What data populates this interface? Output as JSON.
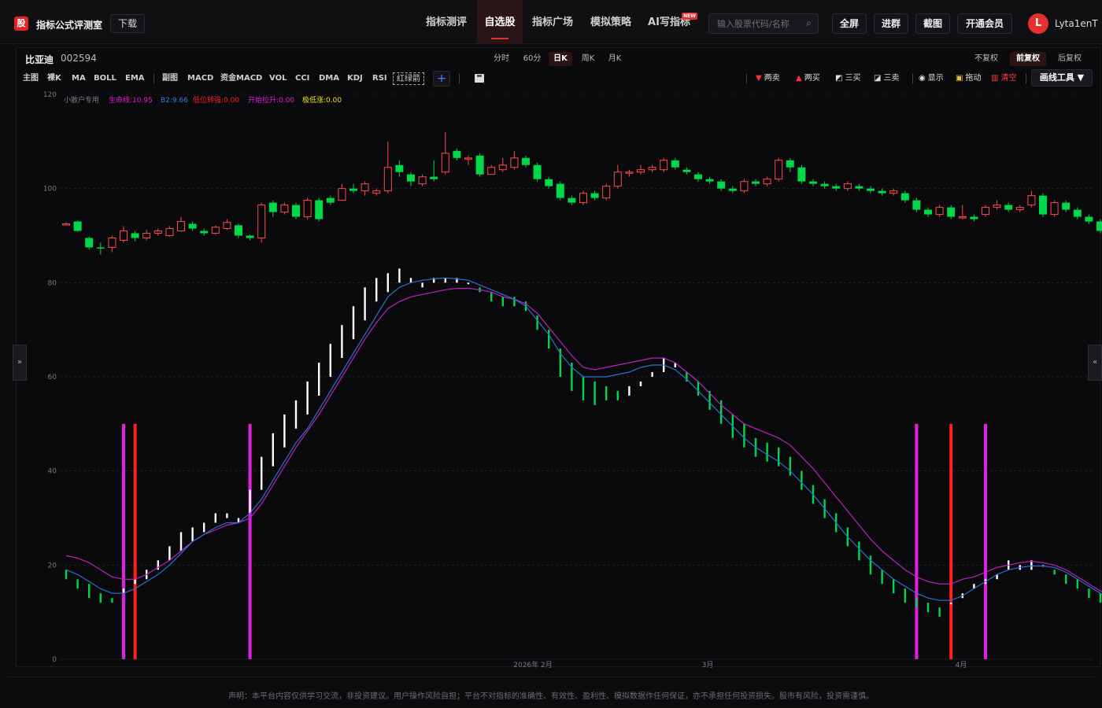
{
  "app": {
    "logo_char": "股",
    "name": "指标公式评测室",
    "download": "下载"
  },
  "nav": [
    "指标测评",
    "自选股",
    "指标广场",
    "模拟策略",
    "AI写指标"
  ],
  "nav_active": 1,
  "new_badge": "NEW",
  "search": {
    "placeholder": "输入股票代码/名称",
    "icon": "search-icon"
  },
  "header_buttons": [
    "全屏",
    "进群",
    "截图",
    "开通会员"
  ],
  "user": {
    "initial": "L",
    "name": "Lyta1enT"
  },
  "stock": {
    "name": "比亚迪",
    "code": "002594"
  },
  "periods": [
    "分时",
    "60分",
    "日K",
    "周K",
    "月K"
  ],
  "period_active": 2,
  "fq_modes": [
    "不复权",
    "前复权",
    "后复权"
  ],
  "fq_active": 1,
  "indicators": [
    "主图",
    "裸K",
    "MA",
    "BOLL",
    "EMA"
  ],
  "sub_indicators": [
    "副图",
    "MACD",
    "资金MACD",
    "VOL",
    "CCI",
    "DMA",
    "KDJ",
    "RSI"
  ],
  "red_green_arrow": "红绿箭",
  "plus": "+",
  "tools": [
    {
      "icon": "down-triangle-icon",
      "glyph": "▼",
      "label": "两卖",
      "color": "#ff3030"
    },
    {
      "icon": "up-triangle-icon",
      "glyph": "▲",
      "label": "两买",
      "color": "#ff3030"
    },
    {
      "icon": "chart-up-icon",
      "glyph": "◩",
      "label": "三买",
      "color": "#dddddd"
    },
    {
      "icon": "chart-down-icon",
      "glyph": "◪",
      "label": "三卖",
      "color": "#dddddd"
    },
    {
      "icon": "eye-icon",
      "glyph": "◉",
      "label": "显示",
      "color": "#dddddd"
    },
    {
      "icon": "lock-icon",
      "glyph": "▣",
      "label": "拖动",
      "color": "#f0c040"
    },
    {
      "icon": "trash-icon",
      "glyph": "▥",
      "label": "清空",
      "color": "#ff4040"
    }
  ],
  "draw_tool": "画线工具 ▼",
  "legend": [
    {
      "text": "小散户专用",
      "color": "#7d7d85"
    },
    {
      "text": "生命线:10.95",
      "color": "#e020e0"
    },
    {
      "text": "B2:9.66",
      "color": "#3a7be0"
    },
    {
      "text": "低位转强:0.00",
      "color": "#ff2020"
    },
    {
      "text": "开始拉升:0.00",
      "color": "#e020e0"
    },
    {
      "text": "极低涨:0.00",
      "color": "#f0e020"
    }
  ],
  "side_left": "»",
  "side_right": "«",
  "colors": {
    "up": "#ff4a4a",
    "down": "#00d84a",
    "bg": "#0a0a0c",
    "accent": "#e53030"
  },
  "chart_data": {
    "type": "candlestick+indicator",
    "ylim": [
      0,
      120
    ],
    "yticks": [
      0,
      20,
      40,
      60,
      80,
      100,
      120
    ],
    "xticks": [
      "2026年 2月",
      "3月",
      "4月"
    ],
    "candles": [
      [
        92.5,
        92.5,
        92.8,
        92.2
      ],
      [
        93,
        91,
        93.2,
        90.8
      ],
      [
        89.5,
        87.5,
        89.8,
        87
      ],
      [
        87.5,
        87.3,
        88.5,
        86
      ],
      [
        87.5,
        89.5,
        90,
        86.5
      ],
      [
        89,
        91,
        92,
        88.5
      ],
      [
        90.5,
        89.5,
        91,
        88.8
      ],
      [
        89.5,
        90.5,
        91.2,
        89
      ],
      [
        90.5,
        91,
        91.5,
        90
      ],
      [
        90,
        91.5,
        92,
        89.8
      ],
      [
        91,
        93,
        94,
        90.8
      ],
      [
        92.5,
        91.5,
        93,
        91
      ],
      [
        91,
        90.5,
        91.5,
        90
      ],
      [
        90.5,
        91.8,
        92.2,
        90.2
      ],
      [
        91.5,
        92.8,
        93.5,
        91.2
      ],
      [
        92.2,
        90,
        92.5,
        89.5
      ],
      [
        90,
        89.5,
        90.2,
        89
      ],
      [
        89.5,
        96.5,
        97,
        88.5
      ],
      [
        97,
        95,
        97.5,
        94
      ],
      [
        95,
        96.5,
        97,
        94.5
      ],
      [
        96.5,
        94,
        97,
        93.5
      ],
      [
        94,
        97.5,
        98,
        93.5
      ],
      [
        97.5,
        93.5,
        98,
        93
      ],
      [
        98,
        97,
        98.5,
        96.5
      ],
      [
        97.5,
        100,
        101,
        97.5
      ],
      [
        100,
        99.5,
        101,
        99
      ],
      [
        99.5,
        101,
        101.5,
        98.5
      ],
      [
        99,
        99.5,
        100,
        98.5
      ],
      [
        99.5,
        104.5,
        110,
        99
      ],
      [
        105,
        103.5,
        106,
        102.5
      ],
      [
        103,
        101.5,
        103.5,
        100.5
      ],
      [
        101,
        102.5,
        103,
        100.5
      ],
      [
        102.5,
        102,
        106,
        101.5
      ],
      [
        103.5,
        107.5,
        112,
        103
      ],
      [
        108,
        106.5,
        108.5,
        106
      ],
      [
        106.5,
        106.5,
        107,
        105
      ],
      [
        107,
        103,
        107.5,
        102.5
      ],
      [
        103,
        104.5,
        105,
        103
      ],
      [
        104,
        105,
        106.5,
        103.5
      ],
      [
        104.5,
        106.5,
        108,
        104
      ],
      [
        106.5,
        105,
        107,
        104.5
      ],
      [
        105,
        102,
        105.5,
        101.5
      ],
      [
        102,
        100.5,
        102.5,
        100
      ],
      [
        101,
        98,
        101.5,
        97.5
      ],
      [
        98,
        97,
        98.5,
        96.5
      ],
      [
        97,
        99,
        99.5,
        96.5
      ],
      [
        99,
        98,
        99.5,
        97.5
      ],
      [
        98,
        100.5,
        101,
        97.5
      ],
      [
        100.5,
        103.5,
        105,
        100
      ],
      [
        103.5,
        103.5,
        104,
        102.5
      ],
      [
        103.5,
        104,
        105,
        103
      ],
      [
        104,
        104.5,
        105,
        103.5
      ],
      [
        104,
        106,
        106.5,
        103.5
      ],
      [
        106,
        104.5,
        106.5,
        104
      ],
      [
        104,
        103.5,
        104.5,
        103
      ],
      [
        103,
        102,
        103.5,
        101.5
      ],
      [
        102,
        101.5,
        102.5,
        101
      ],
      [
        101.5,
        100,
        102,
        99.5
      ],
      [
        100,
        99.5,
        100.5,
        99
      ],
      [
        99.5,
        101.5,
        102,
        99
      ],
      [
        101.5,
        101,
        102,
        100.5
      ],
      [
        101,
        102,
        102.5,
        100.5
      ],
      [
        102,
        106,
        106.5,
        101.5
      ],
      [
        106,
        104.5,
        106.5,
        103.5
      ],
      [
        104.5,
        101.5,
        105,
        101
      ],
      [
        101.5,
        101,
        102,
        100.5
      ],
      [
        101,
        100.5,
        101.5,
        100
      ],
      [
        100.5,
        100,
        101,
        99.5
      ],
      [
        100,
        101,
        101.5,
        99.5
      ],
      [
        100.5,
        100,
        101,
        99.5
      ],
      [
        100,
        99.5,
        100.5,
        99
      ],
      [
        99.5,
        99,
        100,
        98.5
      ],
      [
        99,
        99.5,
        100,
        98.5
      ],
      [
        99,
        97.5,
        99.5,
        97
      ],
      [
        97.5,
        95.5,
        98,
        95
      ],
      [
        95.5,
        94.5,
        96,
        94
      ],
      [
        94.5,
        96,
        96.5,
        94
      ],
      [
        96,
        94,
        96.5,
        93.5
      ],
      [
        94,
        94,
        96.5,
        93.5
      ],
      [
        94,
        93.5,
        94.5,
        93
      ],
      [
        94.5,
        96,
        96.5,
        94
      ],
      [
        96,
        96.5,
        97.5,
        95.5
      ],
      [
        96.5,
        95.5,
        97,
        95
      ],
      [
        95.5,
        96,
        96.5,
        95
      ],
      [
        96.5,
        98.5,
        99.5,
        96
      ],
      [
        98.5,
        94.5,
        99,
        94
      ],
      [
        94.5,
        97,
        97.5,
        94
      ],
      [
        97,
        95.5,
        97.5,
        95
      ],
      [
        95.5,
        94,
        96,
        93.5
      ],
      [
        94,
        93,
        94.5,
        92.5
      ],
      [
        93,
        91,
        93.5,
        90.5
      ],
      [
        91,
        92.5,
        93,
        90.5
      ],
      [
        92.5,
        91,
        93,
        90.5
      ],
      [
        91,
        90,
        91.5,
        89.5
      ],
      [
        90,
        91.5,
        92,
        89.5
      ],
      [
        91.5,
        91.5,
        92,
        90.5
      ],
      [
        91.5,
        90.5,
        92,
        90
      ],
      [
        90,
        88,
        90.5,
        87.5
      ]
    ],
    "cross_count": [
      {
        "index": 14,
        "color": "#ff2020"
      }
    ],
    "indicator_bars": [
      [
        19,
        17
      ],
      [
        17,
        15
      ],
      [
        16,
        13
      ],
      [
        14,
        12
      ],
      [
        13,
        12
      ],
      [
        14,
        15
      ],
      [
        16,
        17
      ],
      [
        17,
        19
      ],
      [
        19,
        21
      ],
      [
        21,
        24
      ],
      [
        23,
        27
      ],
      [
        25,
        28
      ],
      [
        27,
        29
      ],
      [
        29,
        31
      ],
      [
        30,
        31
      ],
      [
        29,
        30
      ],
      [
        31,
        36
      ],
      [
        36,
        43
      ],
      [
        41,
        48
      ],
      [
        45,
        52
      ],
      [
        49,
        55
      ],
      [
        52,
        59
      ],
      [
        56,
        63
      ],
      [
        60,
        67
      ],
      [
        64,
        71
      ],
      [
        68,
        75
      ],
      [
        72,
        79
      ],
      [
        76,
        81
      ],
      [
        78,
        82
      ],
      [
        80,
        83
      ],
      [
        80,
        81
      ],
      [
        79,
        80
      ],
      [
        80,
        81
      ],
      [
        80,
        81
      ],
      [
        80,
        81
      ],
      [
        80,
        80
      ],
      [
        79,
        78
      ],
      [
        78,
        76
      ],
      [
        77,
        75
      ],
      [
        77,
        75
      ],
      [
        76,
        74
      ],
      [
        73,
        70
      ],
      [
        70,
        66
      ],
      [
        66,
        60
      ],
      [
        63,
        57
      ],
      [
        60,
        55
      ],
      [
        59,
        54
      ],
      [
        58,
        55
      ],
      [
        57,
        55
      ],
      [
        56,
        58
      ],
      [
        58,
        59
      ],
      [
        60,
        61
      ],
      [
        61,
        64
      ],
      [
        62,
        63
      ],
      [
        61,
        59
      ],
      [
        59,
        56
      ],
      [
        57,
        53
      ],
      [
        55,
        50
      ],
      [
        52,
        47
      ],
      [
        50,
        45
      ],
      [
        47,
        43
      ],
      [
        46,
        42
      ],
      [
        45,
        41
      ],
      [
        43,
        39
      ],
      [
        40,
        36
      ],
      [
        37,
        33
      ],
      [
        34,
        30
      ],
      [
        31,
        27
      ],
      [
        28,
        24
      ],
      [
        25,
        21
      ],
      [
        22,
        18
      ],
      [
        19,
        16
      ],
      [
        17,
        14
      ],
      [
        15,
        12
      ],
      [
        13,
        11
      ],
      [
        12,
        10
      ],
      [
        11,
        9
      ],
      [
        12,
        12
      ],
      [
        13,
        14
      ],
      [
        15,
        16
      ],
      [
        16,
        17
      ],
      [
        17,
        18
      ],
      [
        19,
        21
      ],
      [
        19,
        20
      ],
      [
        19,
        21
      ],
      [
        20,
        20
      ],
      [
        19,
        18
      ],
      [
        18,
        16
      ],
      [
        17,
        15
      ],
      [
        15,
        13
      ],
      [
        14,
        12
      ],
      [
        13,
        11
      ],
      [
        11,
        10
      ],
      [
        10,
        10
      ],
      [
        10,
        10
      ],
      [
        10,
        9
      ],
      [
        9,
        8
      ]
    ],
    "b2_line": [
      19,
      18,
      16.5,
      15,
      14,
      14,
      15,
      16.5,
      18,
      20,
      22.5,
      25,
      26.5,
      28,
      29,
      29,
      31,
      34,
      38,
      42,
      46,
      49,
      53,
      57,
      61,
      65,
      69,
      73,
      77,
      79,
      80,
      80.5,
      80.8,
      81,
      80.8,
      80.5,
      79.5,
      78.5,
      77.5,
      76.5,
      75,
      72,
      69,
      65,
      62,
      60,
      60,
      60,
      60.5,
      61,
      62,
      62.5,
      62.5,
      61.5,
      59.5,
      57,
      54.5,
      52,
      49.5,
      47,
      45,
      43.5,
      42,
      40,
      37.5,
      35,
      32,
      29,
      26,
      23.5,
      21,
      19,
      17,
      15.5,
      14,
      13,
      12.5,
      12.5,
      13.5,
      15,
      16.5,
      18,
      19,
      19.5,
      19.8,
      19.8,
      19.5,
      18.5,
      17,
      15.5,
      14,
      12.5,
      11.5,
      11,
      10.8,
      10.5,
      9.7
    ],
    "life_line": [
      22,
      21.5,
      20.5,
      19,
      17.5,
      17,
      17,
      18,
      19.5,
      21,
      23,
      25,
      26.5,
      27.5,
      28.5,
      29,
      30,
      33,
      37,
      41,
      45,
      48.5,
      52,
      56,
      60,
      64,
      68,
      71.5,
      74.5,
      76,
      77,
      77.5,
      78,
      78.5,
      78.8,
      78.8,
      78.5,
      78,
      77,
      76.5,
      75.5,
      73.5,
      70.5,
      67.5,
      64.5,
      62,
      61.5,
      62,
      62.5,
      63,
      63.5,
      64,
      64,
      63,
      61,
      59,
      56.5,
      54,
      52,
      50,
      49,
      48,
      47,
      45.5,
      43,
      40.5,
      37.5,
      34.5,
      31.5,
      28.5,
      25.5,
      23,
      21,
      19,
      17.5,
      16.5,
      16,
      16,
      17,
      17.5,
      18.5,
      19.5,
      20,
      20.5,
      20.8,
      20.5,
      20,
      19,
      17.5,
      16,
      14.5,
      13.5,
      12.5,
      12,
      11.8,
      11.5,
      11
    ],
    "signal_bars": [
      {
        "index": 5,
        "color": "#e020e0"
      },
      {
        "index": 6,
        "color": "#ff2020"
      },
      {
        "index": 16,
        "color": "#e020e0"
      },
      {
        "index": 74,
        "color": "#e020e0"
      },
      {
        "index": 77,
        "color": "#ff2020"
      },
      {
        "index": 80,
        "color": "#e020e0"
      }
    ],
    "signal_height": 50
  },
  "disclaimer": "声明：本平台内容仅供学习交流，非投资建议。用户操作风险自担；平台不对指标的准确性、有效性、盈利性、模拟数据作任何保证，亦不承担任何投资损失。股市有风险，投资需谨慎。"
}
